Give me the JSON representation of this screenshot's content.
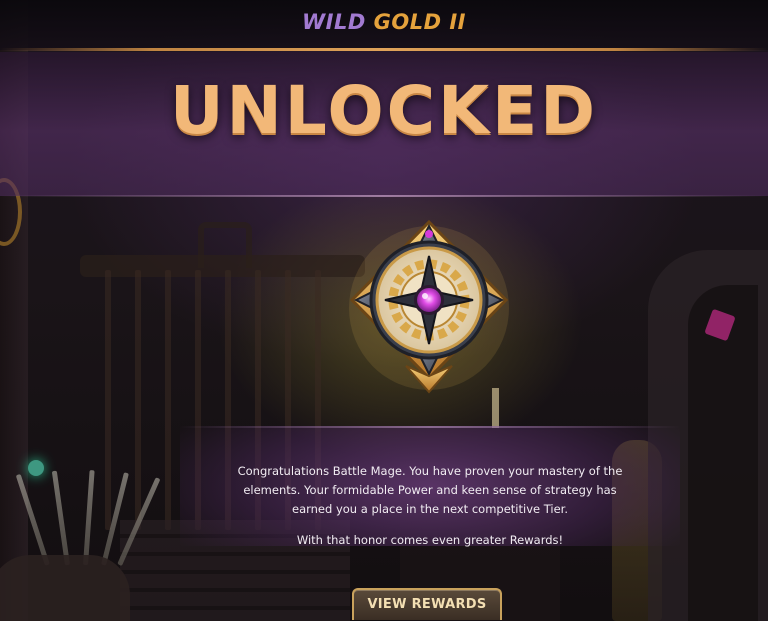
{
  "tier": {
    "wild_label": "WILD",
    "gold_label": "GOLD II"
  },
  "banner": {
    "title": "UNLOCKED"
  },
  "emblem": {
    "icon": "gold-tier-emblem-icon"
  },
  "message": {
    "body": "Congratulations Battle Mage. You have proven your mastery of the elements. Your formidable Power and keen sense of strategy has earned you a place in the next competitive Tier.",
    "footer": "With that honor comes even greater Rewards!"
  },
  "actions": {
    "view_rewards_label": "VIEW REWARDS"
  },
  "colors": {
    "wild": "#a27ad1",
    "gold": "#e5a23c",
    "title": "#f2b878",
    "gem": "#d33bd9"
  }
}
